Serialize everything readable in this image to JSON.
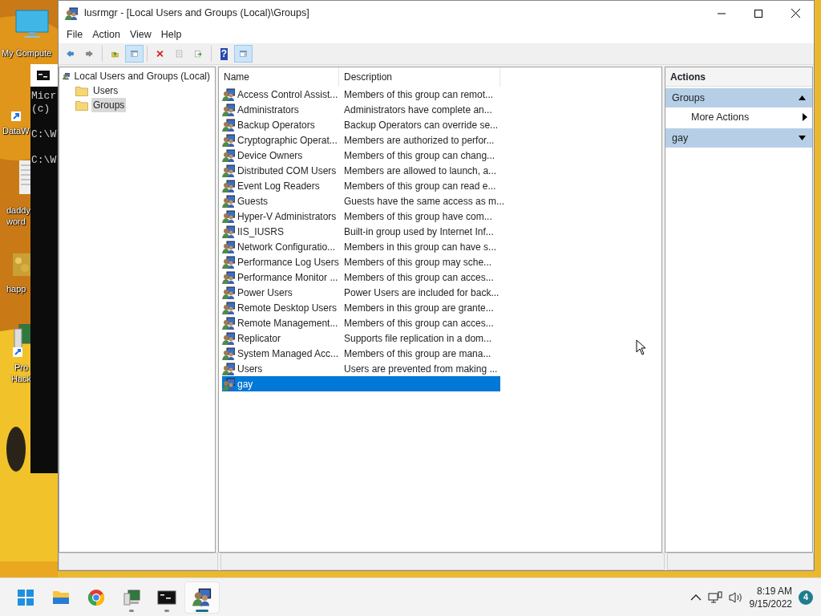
{
  "desktop": {
    "icons": [
      {
        "kind": "monitor",
        "lines": [
          "My Compute"
        ]
      },
      {
        "kind": "shortcut",
        "lines": [
          "DataW"
        ]
      },
      {
        "kind": "document",
        "lines": [
          "daddy",
          "word"
        ]
      },
      {
        "lines": [
          "happ"
        ]
      },
      {
        "kind": "computer",
        "lines": [
          "Pro",
          "Hack"
        ]
      }
    ]
  },
  "console_window": {
    "blocks": [
      [
        "Micr",
        "(c)"
      ],
      [
        "C:\\W"
      ],
      [
        "C:\\W"
      ]
    ]
  },
  "window": {
    "title": "lusrmgr - [Local Users and Groups (Local)\\Groups]",
    "menu": [
      "File",
      "Action",
      "View",
      "Help"
    ],
    "toolbar": [
      {
        "kind": "back",
        "pressed": false
      },
      {
        "kind": "forward",
        "pressed": false
      },
      {
        "kind": "separator"
      },
      {
        "kind": "up",
        "pressed": false
      },
      {
        "kind": "tree",
        "pressed": true
      },
      {
        "kind": "separator"
      },
      {
        "kind": "delete",
        "pressed": false
      },
      {
        "kind": "properties",
        "pressed": false
      },
      {
        "kind": "export",
        "pressed": false
      },
      {
        "kind": "separator"
      },
      {
        "kind": "help",
        "pressed": false,
        "label": "?"
      },
      {
        "kind": "actionpane",
        "pressed": true
      }
    ],
    "tree": {
      "label": "Local Users and Groups (Local)",
      "children": [
        {
          "label": "Users",
          "selected": false
        },
        {
          "label": "Groups",
          "selected": true
        }
      ]
    },
    "table": {
      "columns": [
        "Name",
        "Description"
      ],
      "rows": [
        {
          "name": "Access Control Assist...",
          "description": "Members of this group can remot...",
          "selected": false
        },
        {
          "name": "Administrators",
          "description": "Administrators have complete an...",
          "selected": false
        },
        {
          "name": "Backup Operators",
          "description": "Backup Operators can override se...",
          "selected": false
        },
        {
          "name": "Cryptographic Operat...",
          "description": "Members are authorized to perfor...",
          "selected": false
        },
        {
          "name": "Device Owners",
          "description": "Members of this group can chang...",
          "selected": false
        },
        {
          "name": "Distributed COM Users",
          "description": "Members are allowed to launch, a...",
          "selected": false
        },
        {
          "name": "Event Log Readers",
          "description": "Members of this group can read e...",
          "selected": false
        },
        {
          "name": "Guests",
          "description": "Guests have the same access as m...",
          "selected": false
        },
        {
          "name": "Hyper-V Administrators",
          "description": "Members of this group have com...",
          "selected": false
        },
        {
          "name": "IIS_IUSRS",
          "description": "Built-in group used by Internet Inf...",
          "selected": false
        },
        {
          "name": "Network Configuratio...",
          "description": "Members in this group can have s...",
          "selected": false
        },
        {
          "name": "Performance Log Users",
          "description": "Members of this group may sche...",
          "selected": false
        },
        {
          "name": "Performance Monitor ...",
          "description": "Members of this group can acces...",
          "selected": false
        },
        {
          "name": "Power Users",
          "description": "Power Users are included for back...",
          "selected": false
        },
        {
          "name": "Remote Desktop Users",
          "description": "Members in this group are grante...",
          "selected": false
        },
        {
          "name": "Remote Management...",
          "description": "Members of this group can acces...",
          "selected": false
        },
        {
          "name": "Replicator",
          "description": "Supports file replication in a dom...",
          "selected": false
        },
        {
          "name": "System Managed Acc...",
          "description": "Members of this group are mana...",
          "selected": false
        },
        {
          "name": "Users",
          "description": "Users are prevented from making ...",
          "selected": false
        },
        {
          "name": "gay",
          "selected": true
        }
      ]
    },
    "actions": {
      "title": "Actions",
      "sections": [
        {
          "title": "Groups",
          "expanded": true,
          "items": [
            "More Actions"
          ]
        },
        {
          "title": "gay",
          "expanded": false
        }
      ]
    }
  },
  "taskbar": {
    "apps": [
      {
        "kind": "start",
        "running": false,
        "active": false
      },
      {
        "kind": "folder",
        "running": false,
        "active": false
      },
      {
        "kind": "browser",
        "running": false,
        "active": false
      },
      {
        "kind": "computer",
        "running": true,
        "active": false
      },
      {
        "kind": "console",
        "running": true,
        "active": false
      },
      {
        "kind": "users",
        "running": true,
        "active": true
      }
    ],
    "time": "8:19 AM",
    "date": "9/15/2022",
    "notifications": "4"
  }
}
